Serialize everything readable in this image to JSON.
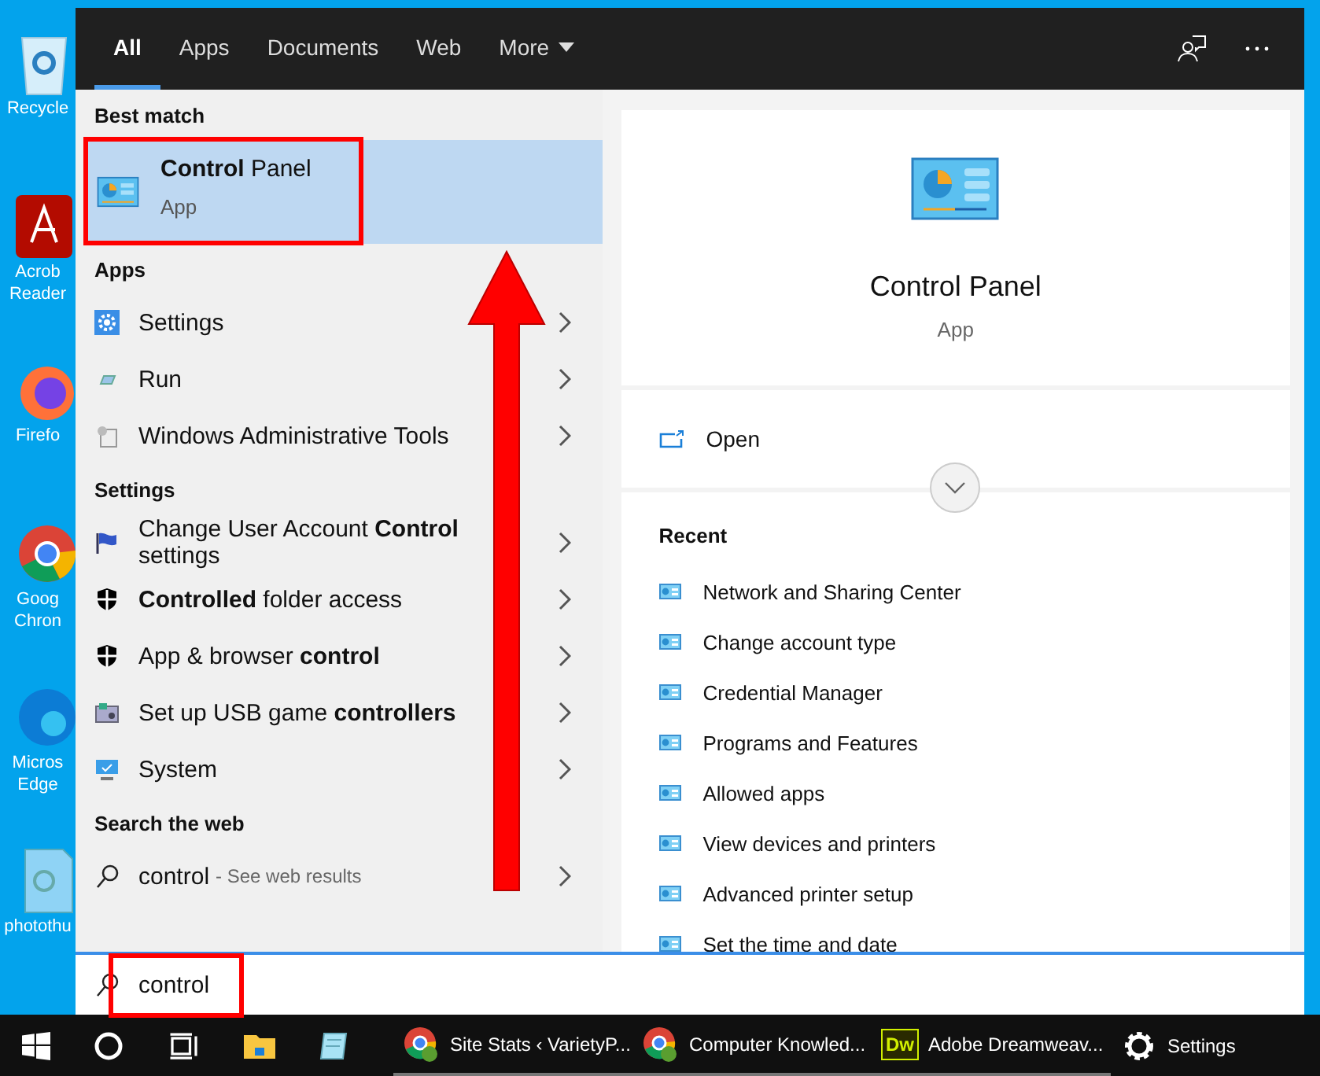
{
  "desktop_icons": [
    {
      "kind": "recycle-bin",
      "lines": [
        "Recycle"
      ]
    },
    {
      "kind": "pdf",
      "lines": [
        "Acrob",
        "Reader"
      ]
    },
    {
      "kind": "firefox",
      "lines": [
        "Firefo"
      ]
    },
    {
      "kind": "chrome",
      "lines": [
        "Goog",
        "Chron"
      ]
    },
    {
      "kind": "edge",
      "lines": [
        "Micros",
        "Edge"
      ]
    },
    {
      "kind": "file",
      "lines": [
        "photothu"
      ]
    }
  ],
  "tabs": [
    {
      "label": "All",
      "selected": true,
      "kind": "tab"
    },
    {
      "label": "Apps",
      "selected": false,
      "kind": "tab"
    },
    {
      "label": "Documents",
      "selected": false,
      "kind": "tab"
    },
    {
      "label": "Web",
      "selected": false,
      "kind": "tab"
    },
    {
      "label": "More",
      "selected": false,
      "kind": "dropdown"
    }
  ],
  "best_match": {
    "heading": "Best match",
    "title": "**Control** Panel",
    "subtitle": "App",
    "selected": true
  },
  "sections": [
    {
      "heading": "Apps",
      "items": [
        {
          "kind": "gear",
          "text": "Settings"
        },
        {
          "kind": "run",
          "text": "Run"
        },
        {
          "kind": "tools",
          "text": "Windows Administrative Tools"
        }
      ]
    },
    {
      "heading": "Settings",
      "items": [
        {
          "kind": "flag",
          "text": "Change User Account **Control** settings"
        },
        {
          "kind": "shield",
          "text": "**Controlled** folder access"
        },
        {
          "kind": "shield",
          "text": "App & browser **control**"
        },
        {
          "kind": "gamepad",
          "text": "Set up USB game **controllers**"
        },
        {
          "kind": "monitor",
          "text": "System"
        }
      ]
    }
  ],
  "web": {
    "heading": "Search the web",
    "query": "control",
    "suffix": "- See web results"
  },
  "preview": {
    "title": "Control Panel",
    "subtitle": "App",
    "action": "Open",
    "recent_heading": "Recent",
    "recent": [
      "Network and Sharing Center",
      "Change account type",
      "Credential Manager",
      "Programs and Features",
      "Allowed apps",
      "View devices and printers",
      "Advanced printer setup",
      "Set the time and date"
    ]
  },
  "search": {
    "value": "control"
  },
  "taskbar": {
    "pinned": [
      {
        "kind": "explorer"
      },
      {
        "kind": "notepad"
      }
    ],
    "tasks": [
      {
        "kind": "chrome",
        "label": "Site Stats ‹ VarietyP..."
      },
      {
        "kind": "chrome",
        "label": "Computer Knowled..."
      },
      {
        "kind": "dreamweaver",
        "badge": "Dw",
        "label": "Adobe Dreamweav..."
      },
      {
        "kind": "settings",
        "label": "Settings"
      }
    ]
  }
}
